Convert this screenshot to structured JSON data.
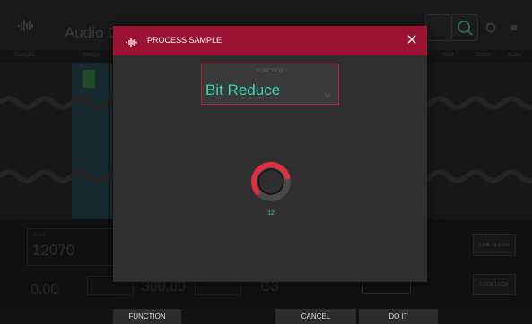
{
  "app": {
    "title": "Audio 00",
    "subbar": [
      "Samples",
      "Sample",
      "Grid",
      "Zoom",
      "Audio"
    ],
    "start_label": "Start",
    "start_value": "12070",
    "value_a": "0.00",
    "value_b": "300.00",
    "value_c": "C3",
    "side_buttons": [
      "LINK SLICES",
      "LOOP LOCK"
    ]
  },
  "dialog": {
    "title": "PROCESS SAMPLE",
    "function_label": "FUNCTION",
    "function_value": "Bit Reduce",
    "knob_value": "12",
    "knob_fraction": 0.8
  },
  "bottom": {
    "function_label": "FUNCTION",
    "cancel_label": "CANCEL",
    "do_it_label": "DO IT"
  },
  "colors": {
    "accent": "#9c1233",
    "teal": "#3fd7b4",
    "knob_ring": "#e0303f"
  },
  "icons": {
    "dialog": "waveform-icon",
    "close": "close-icon",
    "chevron": "chevron-down-icon"
  }
}
